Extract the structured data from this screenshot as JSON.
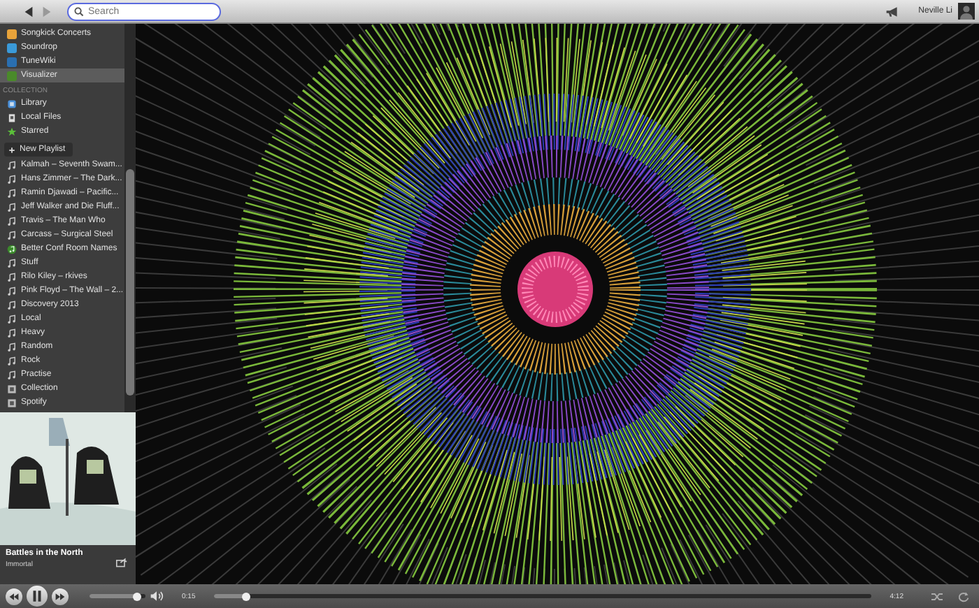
{
  "top_bar": {
    "search": {
      "placeholder": "Search"
    },
    "user": "Neville Li"
  },
  "sidebar": {
    "apps": [
      {
        "label": "Songkick Concerts",
        "color": "#e8a33a",
        "selected": false
      },
      {
        "label": "Soundrop",
        "color": "#3a9ad9",
        "selected": false
      },
      {
        "label": "TuneWiki",
        "color": "#2a6fb0",
        "selected": false
      },
      {
        "label": "Visualizer",
        "color": "#4a8a2a",
        "selected": true
      }
    ],
    "collection_header": "COLLECTION",
    "collection": [
      {
        "label": "Library",
        "kind": "library",
        "selected": false
      },
      {
        "label": "Local Files",
        "kind": "files",
        "selected": false
      },
      {
        "label": "Starred",
        "kind": "star",
        "selected": false
      }
    ],
    "new_playlist": "New Playlist",
    "playlists": [
      {
        "label": "Kalmah – Seventh Swam...",
        "kind": "playlist"
      },
      {
        "label": "Hans Zimmer – The Dark...",
        "kind": "playlist"
      },
      {
        "label": "Ramin Djawadi – Pacific...",
        "kind": "playlist"
      },
      {
        "label": "Jeff Walker and Die Fluff...",
        "kind": "playlist"
      },
      {
        "label": "Travis – The Man Who",
        "kind": "playlist"
      },
      {
        "label": "Carcass – Surgical Steel",
        "kind": "playlist"
      },
      {
        "label": "Better Conf Room Names",
        "kind": "shared"
      },
      {
        "label": "Stuff",
        "kind": "playlist"
      },
      {
        "label": "Rilo Kiley – rkives",
        "kind": "playlist"
      },
      {
        "label": "Pink Floyd – The Wall – 2...",
        "kind": "playlist"
      },
      {
        "label": "Discovery 2013",
        "kind": "playlist"
      },
      {
        "label": "Local",
        "kind": "playlist"
      },
      {
        "label": "Heavy",
        "kind": "playlist"
      },
      {
        "label": "Random",
        "kind": "playlist"
      },
      {
        "label": "Rock",
        "kind": "playlist"
      },
      {
        "label": "Practise",
        "kind": "playlist"
      },
      {
        "label": "Collection",
        "kind": "folder"
      },
      {
        "label": "Spotify",
        "kind": "folder"
      }
    ]
  },
  "now_playing": {
    "title": "Battles in the North",
    "artist": "Immortal"
  },
  "player": {
    "playing": true,
    "volume": {
      "level": 0.85
    },
    "elapsed": "0:15",
    "total": "4:12",
    "progress": {
      "level": 0.05
    }
  }
}
